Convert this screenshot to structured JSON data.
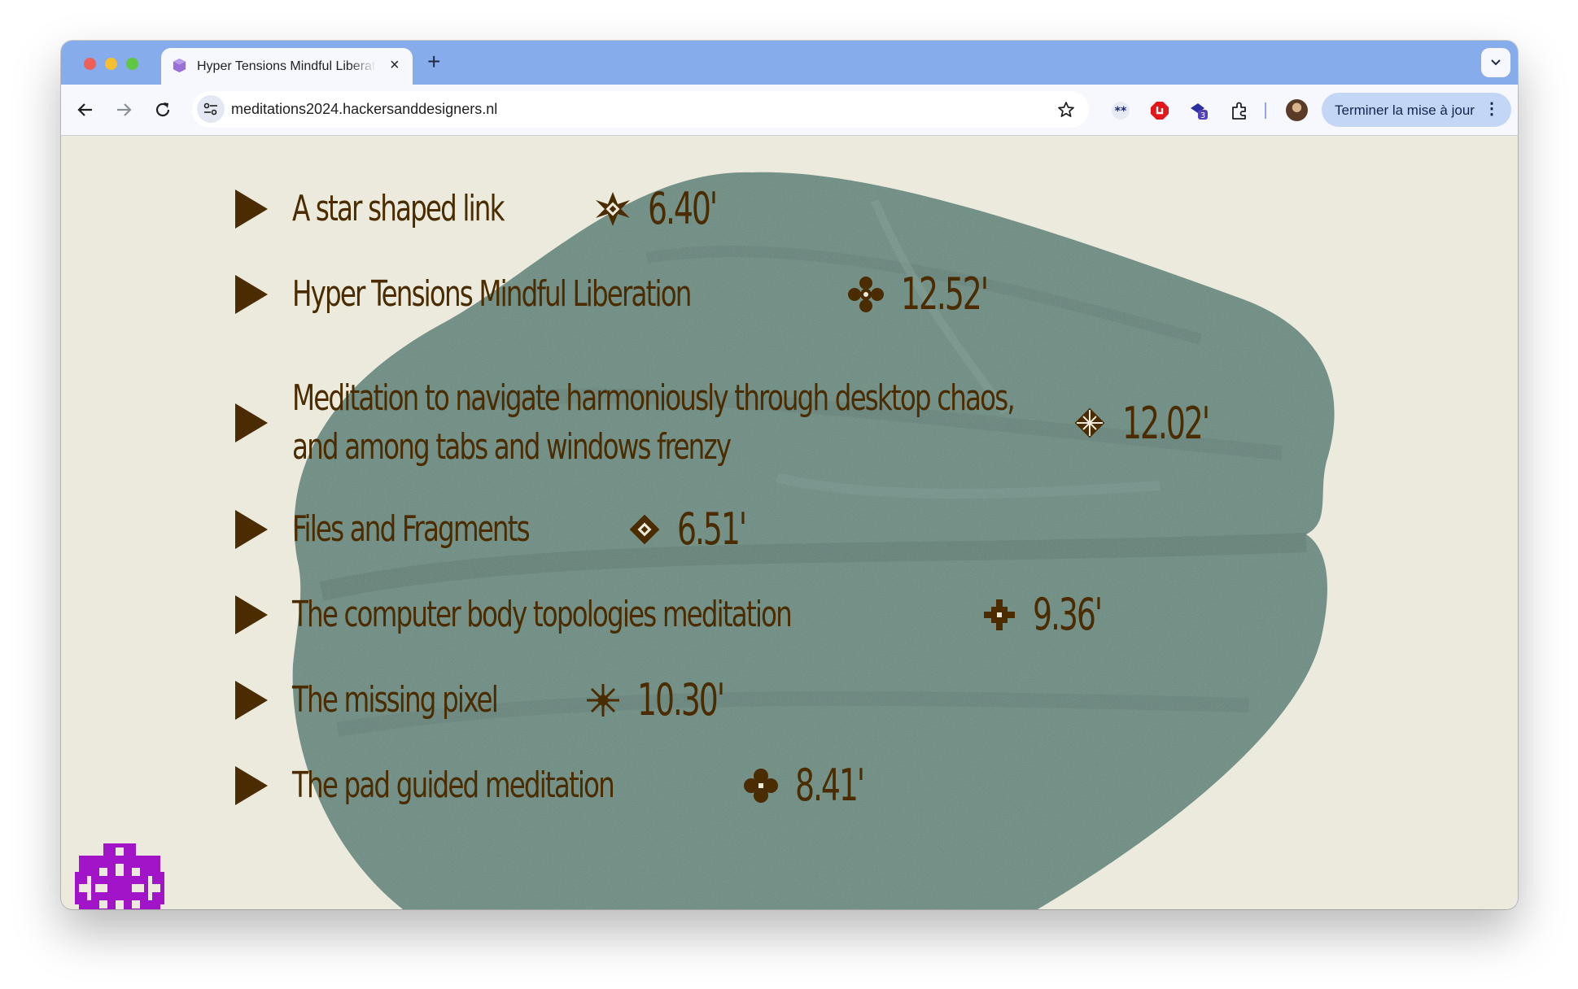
{
  "browser": {
    "tab_title": "Hyper Tensions Mindful Liberation",
    "tab_close": "×",
    "new_tab": "+",
    "url": "meditations2024.hackersanddesigners.nl",
    "update_button": "Terminer la mise à jour",
    "update_menu": "⋮",
    "extension_badge": "3"
  },
  "colors": {
    "tabbar": "#86acec",
    "toolbar": "#f6f8fd",
    "page_background": "#ebeadc",
    "pillow": "#6b8c82",
    "text": "#4a2c00",
    "badge": "#a214c8"
  },
  "meditations": [
    {
      "title": "A star shaped link",
      "glyph": "star-pattern-icon",
      "duration": "6.40'"
    },
    {
      "title": "Hyper Tensions Mindful Liberation",
      "glyph": "flower-pattern-icon",
      "duration": "12.52'"
    },
    {
      "title": "Meditation to navigate harmoniously through desktop chaos, and among tabs and windows frenzy",
      "glyph": "checker-diamond-icon",
      "duration": "12.02'"
    },
    {
      "title": "Files and Fragments",
      "glyph": "diamond-pattern-icon",
      "duration": "6.51'"
    },
    {
      "title": "The computer body topologies meditation",
      "glyph": "cross-pattern-icon",
      "duration": "9.36'"
    },
    {
      "title": "The missing pixel",
      "glyph": "snowflake-pattern-icon",
      "duration": "10.30'"
    },
    {
      "title": "The pad guided meditation",
      "glyph": "blossom-pattern-icon",
      "duration": "8.41'"
    }
  ]
}
